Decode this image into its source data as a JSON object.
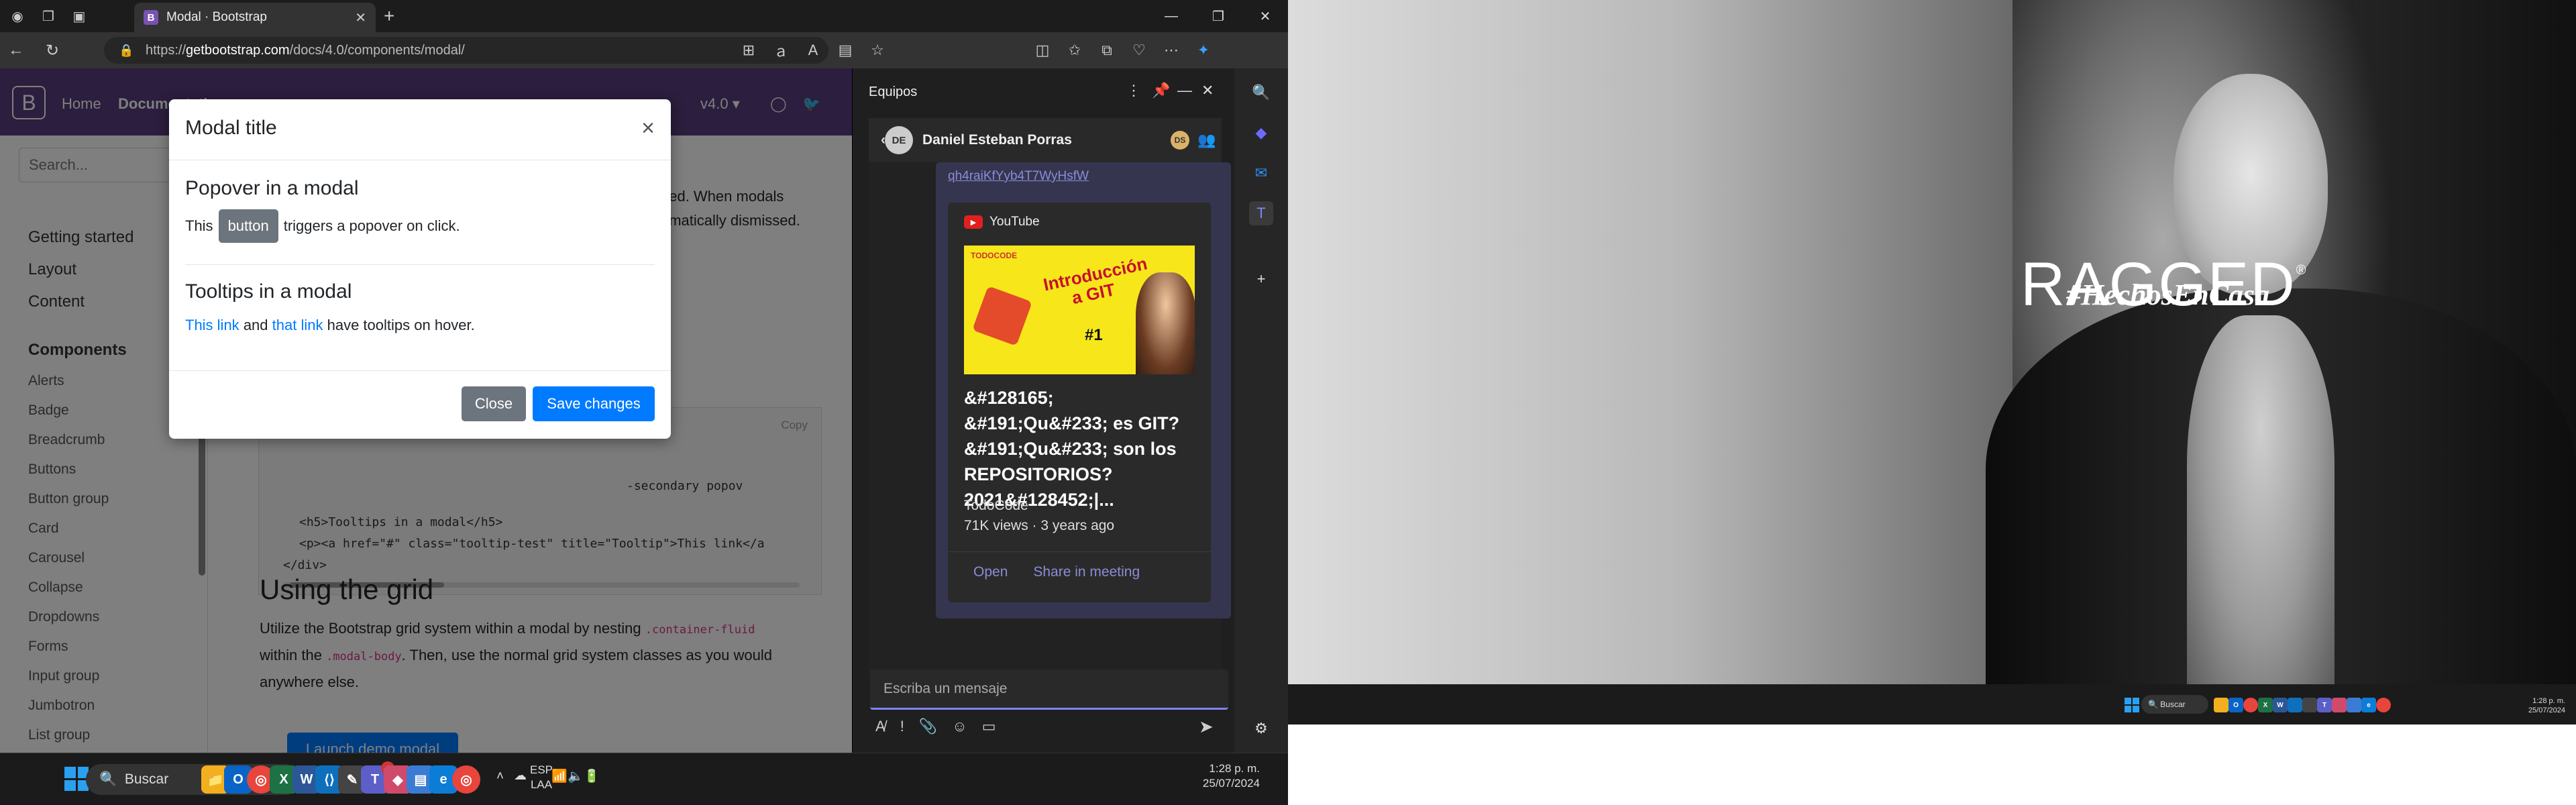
{
  "browser": {
    "tab_title": "Modal · Bootstrap",
    "url_prefix": "https://",
    "url_host": "getbootstrap.com",
    "url_path": "/docs/4.0/components/modal/"
  },
  "bootstrap": {
    "nav_home": "Home",
    "nav_docs": "Documentation",
    "version": "v4.0 ▾",
    "search_placeholder": "Search...",
    "sidebar_sections": [
      "Getting started",
      "Layout",
      "Content"
    ],
    "components_title": "Components",
    "components": [
      "Alerts",
      "Badge",
      "Breadcrumb",
      "Buttons",
      "Button group",
      "Card",
      "Carousel",
      "Collapse",
      "Dropdowns",
      "Forms",
      "Input group",
      "Jumbotron",
      "List group"
    ],
    "body_text_1": "ded. When modals",
    "body_text_2": "omatically dismissed.",
    "copy_label": "Copy",
    "code_line_1": "-secondary popov",
    "code_line_2": "<h5>Tooltips in a modal</h5>",
    "code_line_3": "<p><a href=\"#\" class=\"tooltip-test\" title=\"Tooltip\">This link</a",
    "code_line_4": "</div>",
    "grid_heading": "Using the grid",
    "grid_p_1": "Utilize the Bootstrap grid system within a modal by nesting",
    "grid_code_1": ".container-fluid",
    "grid_p_2": "within the",
    "grid_code_2": ".modal-body",
    "grid_p_3": ". Then, use the normal grid system classes as you would",
    "grid_p_4": "anywhere else.",
    "launch_label": "Launch demo modal"
  },
  "modal": {
    "title": "Modal title",
    "close_symbol": "×",
    "popover_heading": "Popover in a modal",
    "popover_text_pre": "This",
    "popover_button": "button",
    "popover_text_post": "triggers a popover on click.",
    "tooltips_heading": "Tooltips in a modal",
    "link_1": "This link",
    "and_text": "and",
    "link_2": "that link",
    "tooltips_text_post": "have tooltips on hover.",
    "close_button": "Close",
    "save_button": "Save changes"
  },
  "teams": {
    "title": "Equipos",
    "contact_name": "Daniel Esteban Porras",
    "avatar_initials": "DE",
    "link_text": "qh4raiKfYyb4T7WyHsfW",
    "yt_source": "YouTube",
    "thumb_brand": "TODOCODE",
    "thumb_title": "Introducción a GIT",
    "thumb_num": "#1",
    "video_title": "&#128165; &#191;Qu&#233; es GIT? &#191;Qu&#233; son los REPOSITORIOS? 2021&#128452;|...",
    "channel": "TodoCode",
    "views": "71K views · 3 years ago",
    "open_label": "Open",
    "share_label": "Share in meeting",
    "input_placeholder": "Escriba un mensaje"
  },
  "taskbar": {
    "search_label": "Buscar",
    "lang_1": "ESP",
    "lang_2": "LAA",
    "time": "1:28 p. m.",
    "date": "25/07/2024",
    "badge_count": "4"
  },
  "desktop2": {
    "brand": "RAGGED",
    "registered": "®",
    "tagline": "#HechosEnCasa",
    "search_label": "Buscar",
    "time": "1:28 p. m.",
    "date": "25/07/2024"
  }
}
